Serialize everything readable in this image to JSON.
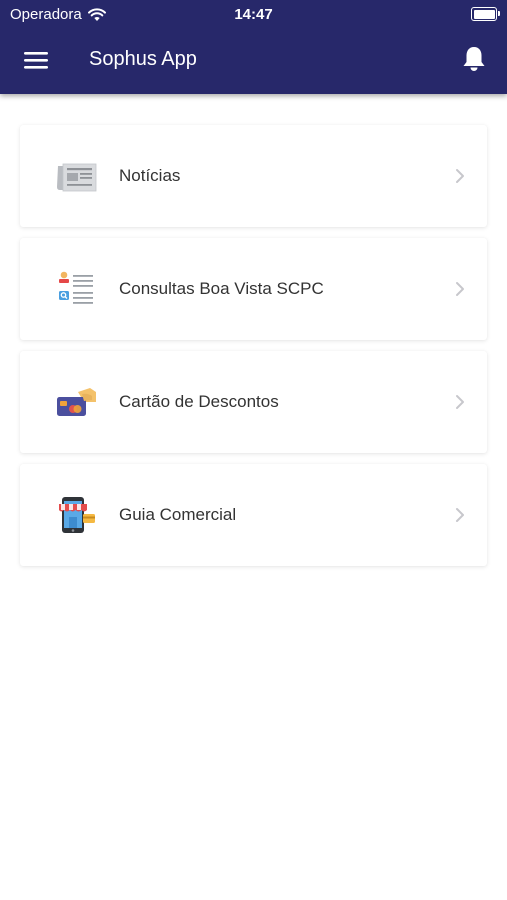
{
  "status_bar": {
    "carrier": "Operadora",
    "time": "14:47"
  },
  "header": {
    "title": "Sophus App",
    "menu_icon": "hamburger-menu-icon",
    "bell_icon": "bell-icon"
  },
  "colors": {
    "header_bg": "#27286a",
    "header_text": "#ffffff",
    "item_text": "#333333",
    "chevron": "#c7c7cc"
  },
  "menu": {
    "items": [
      {
        "label": "Notícias",
        "icon": "newspaper-icon"
      },
      {
        "label": "Consultas Boa Vista SCPC",
        "icon": "credit-report-icon"
      },
      {
        "label": "Cartão de Descontos",
        "icon": "discount-card-icon"
      },
      {
        "label": "Guia Comercial",
        "icon": "mobile-store-icon"
      }
    ]
  }
}
